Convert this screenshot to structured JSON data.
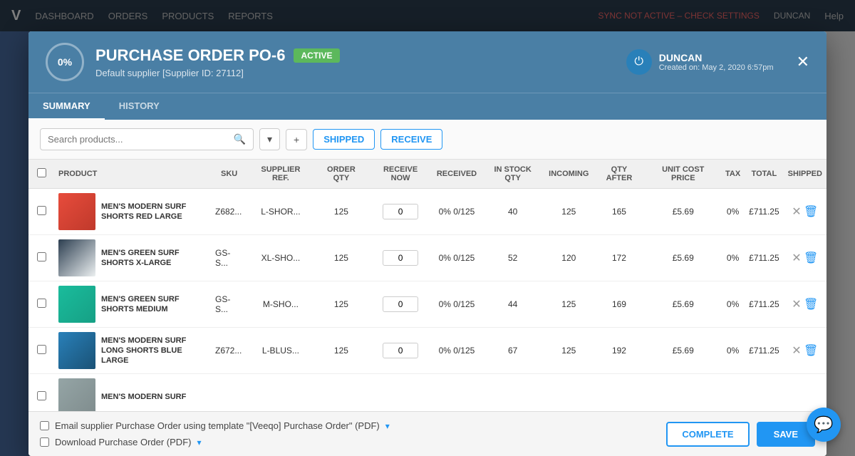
{
  "nav": {
    "logo": "V",
    "items": [
      "DASHBOARD",
      "ORDERS",
      "PRODUCTS",
      "REPORTS"
    ],
    "sync_status": "SYNC NOT ACTIVE – CHECK SETTINGS",
    "user": "DUNCAN",
    "help": "Help"
  },
  "modal": {
    "progress": "0%",
    "title": "PURCHASE ORDER PO-6",
    "status_badge": "ACTIVE",
    "supplier": "Default supplier [Supplier ID: 27112]",
    "user_name": "DUNCAN",
    "created": "Created on: May 2, 2020 6:57pm",
    "tabs": [
      "SUMMARY",
      "HISTORY"
    ],
    "active_tab": "SUMMARY"
  },
  "toolbar": {
    "search_placeholder": "Search products...",
    "shipped_label": "SHIPPED",
    "receive_label": "RECEIVE"
  },
  "table": {
    "headers": [
      "",
      "PRODUCT",
      "SKU",
      "SUPPLIER REF.",
      "ORDER QTY",
      "RECEIVE NOW",
      "RECEIVED",
      "IN STOCK QTY",
      "INCOMING",
      "QTY AFTER",
      "UNIT COST PRICE",
      "TAX",
      "TOTAL",
      "SHIPPED"
    ],
    "rows": [
      {
        "thumb_class": "thumb-red",
        "name": "MEN'S MODERN SURF SHORTS RED LARGE",
        "sku": "Z682...",
        "supplier_ref": "L-SHOR...",
        "order_qty": "125",
        "receive_now": "0",
        "received": "0% 0/125",
        "in_stock": "40",
        "incoming": "125",
        "qty_after": "165",
        "unit_cost": "£5.69",
        "tax": "0%",
        "total": "£711.25"
      },
      {
        "thumb_class": "thumb-black-white",
        "name": "MEN'S GREEN SURF SHORTS X-LARGE",
        "sku": "GS-S...",
        "supplier_ref": "XL-SHO...",
        "order_qty": "125",
        "receive_now": "0",
        "received": "0% 0/125",
        "in_stock": "52",
        "incoming": "120",
        "qty_after": "172",
        "unit_cost": "£5.69",
        "tax": "0%",
        "total": "£711.25"
      },
      {
        "thumb_class": "thumb-teal",
        "name": "MEN'S GREEN SURF SHORTS MEDIUM",
        "sku": "GS-S...",
        "supplier_ref": "M-SHO...",
        "order_qty": "125",
        "receive_now": "0",
        "received": "0% 0/125",
        "in_stock": "44",
        "incoming": "125",
        "qty_after": "169",
        "unit_cost": "£5.69",
        "tax": "0%",
        "total": "£711.25"
      },
      {
        "thumb_class": "thumb-blue",
        "name": "MEN'S MODERN SURF LONG SHORTS BLUE LARGE",
        "sku": "Z672...",
        "supplier_ref": "L-BLUS...",
        "order_qty": "125",
        "receive_now": "0",
        "received": "0% 0/125",
        "in_stock": "67",
        "incoming": "125",
        "qty_after": "192",
        "unit_cost": "£5.69",
        "tax": "0%",
        "total": "£711.25"
      },
      {
        "thumb_class": "thumb-gray",
        "name": "MEN'S MODERN SURF",
        "sku": "",
        "supplier_ref": "",
        "order_qty": "",
        "receive_now": "",
        "received": "",
        "in_stock": "",
        "incoming": "",
        "qty_after": "",
        "unit_cost": "",
        "tax": "",
        "total": ""
      }
    ]
  },
  "footer": {
    "email_label": "Email supplier Purchase Order using template \"[Veeqo] Purchase Order\" (PDF)",
    "download_label": "Download Purchase Order (PDF)",
    "complete_label": "COMPLETE",
    "save_label": "SAVE"
  }
}
